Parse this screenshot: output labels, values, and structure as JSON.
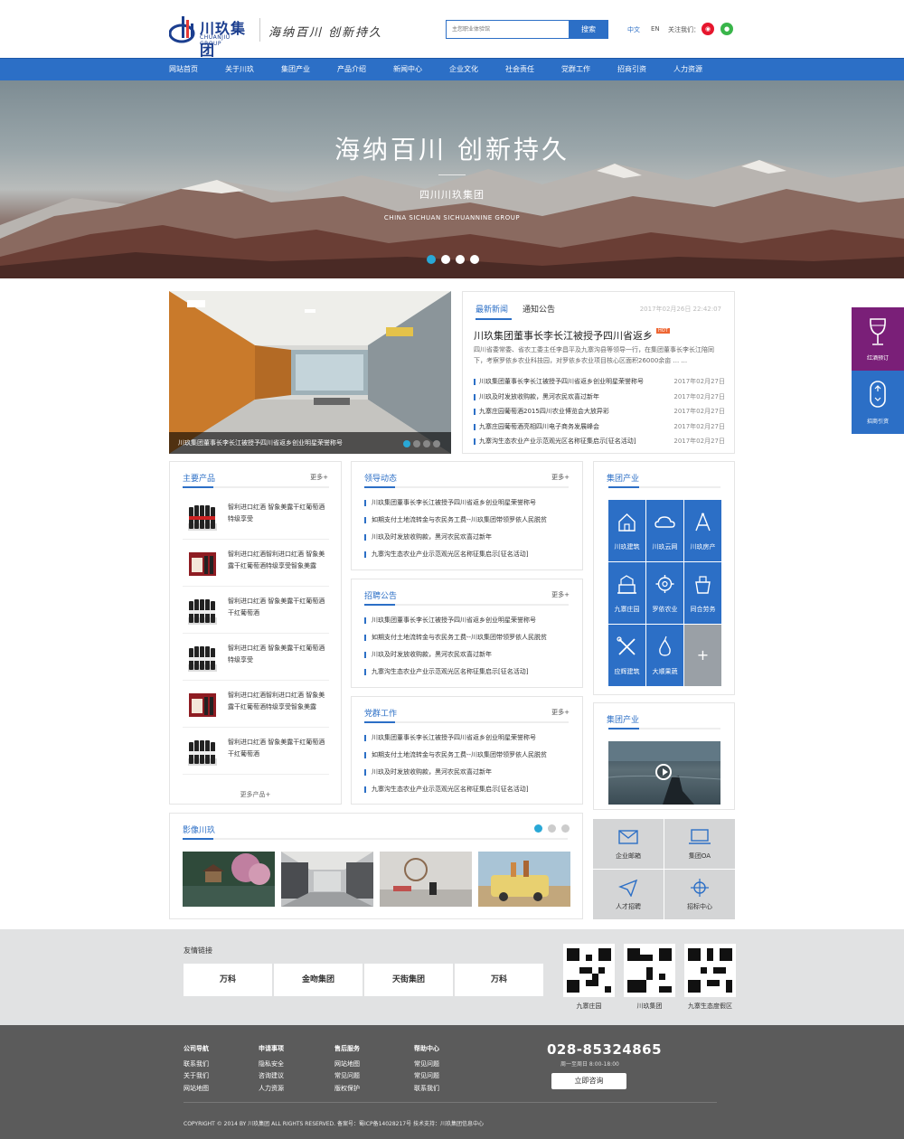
{
  "header": {
    "logo_cn": "川玖集团",
    "logo_en": "CHUANJIU GROUP",
    "slogan": "海纳百川 创新持久",
    "search_placeholder": "主您职业体验馆",
    "search_button": "搜索",
    "lang_cn": "中文",
    "lang_en": "EN",
    "follow": "关注我们：",
    "weibo_icon": "weibo-icon",
    "wechat_icon": "wechat-icon"
  },
  "nav": [
    "网站首页",
    "关于川玖",
    "集团产业",
    "产品介绍",
    "新闻中心",
    "企业文化",
    "社会责任",
    "党群工作",
    "招商引资",
    "人力资源"
  ],
  "hero": {
    "title": "海纳百川  创新持久",
    "subtitle": "四川川玖集团",
    "english": "CHINA  SICHUAN  SICHUANNINE  GROUP",
    "slides": 4,
    "active": 0
  },
  "news": {
    "caption": "川玖集团董事长李长江被授予四川省返乡创业明星荣誉称号",
    "tabs": [
      "最新新闻",
      "通知公告"
    ],
    "date": "2017年02月26日 22:42:07",
    "headline": "川玖集团董事长李长江被授予四川省返乡",
    "hot": "HOT",
    "summary": "四川省委常委、省农工委主任李昌平及九寨沟县等领导一行，在集团董事长李长江陪同下，考察罗依乡农业科技园，对罗依乡农业项目核心区面积26000余亩 ... ...",
    "items": [
      {
        "text": "川玖集团董事长李长江被授予四川省返乡创业明星荣誉称号",
        "date": "2017年02月27日"
      },
      {
        "text": "川玖及时发放收购款，黑河农民欢喜过新年",
        "date": "2017年02月27日"
      },
      {
        "text": "九寨庄园葡萄酒2015四川农业博览会大放异彩",
        "date": "2017年02月27日"
      },
      {
        "text": "九寨庄园葡萄酒亮相四川电子商务发展峰会",
        "date": "2017年02月27日"
      },
      {
        "text": "九寨沟生态农业产业示范观光区名称征集启示[征名活动]",
        "date": "2017年02月27日"
      }
    ]
  },
  "products": {
    "title": "主要产品",
    "more": "更多+",
    "items": [
      "智利进口红酒 智象美露干红葡萄酒特级享受",
      "智利进口红酒智利进口红酒 智象美露干红葡萄酒特级享受智象美露",
      "智利进口红酒 智象美露干红葡萄酒 干红葡萄酒",
      "智利进口红酒 智象美露干红葡萄酒特级享受",
      "智利进口红酒智利进口红酒 智象美露干红葡萄酒特级享受智象美露",
      "智利进口红酒 智象美露干红葡萄酒 干红葡萄酒"
    ],
    "more_products": "更多产品+"
  },
  "leader": {
    "title": "领导动态",
    "more": "更多+",
    "items": [
      "川玖集团董事长李长江被授予四川省返乡创业明星荣誉称号",
      "如期支付土地流转金与农民务工费--川玖集团带领罗依人民脱贫",
      "川玖及时发放收购款，黑河农民欢喜过新年",
      "九寨沟生态农业产业示范观光区名称征集启示[征名活动]"
    ]
  },
  "recruit": {
    "title": "招聘公告",
    "more": "更多+",
    "items": [
      "川玖集团董事长李长江被授予四川省返乡创业明星荣誉称号",
      "如期支付土地流转金与农民务工费--川玖集团带领罗依人民脱贫",
      "川玖及时发放收购款，黑河农民欢喜过新年",
      "九寨沟生态农业产业示范观光区名称征集启示[征名活动]"
    ]
  },
  "party": {
    "title": "党群工作",
    "more": "更多+",
    "items": [
      "川玖集团董事长李长江被授予四川省返乡创业明星荣誉称号",
      "如期支付土地流转金与农民务工费--川玖集团带领罗依人民脱贫",
      "川玖及时发放收购款，黑河农民欢喜过新年",
      "九寨沟生态农业产业示范观光区名称征集启示[征名活动]"
    ]
  },
  "industry": {
    "title": "集团产业",
    "cells": [
      {
        "label": "川玖建筑",
        "icon": "house-icon"
      },
      {
        "label": "川玖云网",
        "icon": "cloud-icon"
      },
      {
        "label": "川玖房产",
        "icon": "compass-icon"
      },
      {
        "label": "九寨庄园",
        "icon": "estate-icon"
      },
      {
        "label": "罗依农业",
        "icon": "gear-icon"
      },
      {
        "label": "同合劳务",
        "icon": "cup-icon"
      },
      {
        "label": "应辉建筑",
        "icon": "tools-icon"
      },
      {
        "label": "大顺果蔬",
        "icon": "pear-icon"
      }
    ],
    "plus": "+"
  },
  "video": {
    "title": "集团产业"
  },
  "gallery": {
    "title": "影像川玖",
    "pages": 3,
    "active": 0
  },
  "tiles": [
    {
      "label": "企业邮箱",
      "icon": "mail-icon"
    },
    {
      "label": "集团OA",
      "icon": "laptop-icon"
    },
    {
      "label": "人才招聘",
      "icon": "send-icon"
    },
    {
      "label": "招标中心",
      "icon": "crosshair-icon"
    }
  ],
  "links": {
    "title": "友情链接",
    "partners": [
      "万科",
      "金吻集团",
      "天街集团",
      "万科"
    ],
    "qrs": [
      "九寨庄园",
      "川玖集团",
      "九寨生态度假区"
    ]
  },
  "footer": {
    "cols": [
      {
        "title": "公司导航",
        "items": [
          "联系我们",
          "关于我们",
          "网站地图"
        ]
      },
      {
        "title": "申请事项",
        "items": [
          "隐私安全",
          "咨询建议",
          "人力资源"
        ]
      },
      {
        "title": "售后服务",
        "items": [
          "网站地图",
          "常见问题",
          "版权保护"
        ]
      },
      {
        "title": "帮助中心",
        "items": [
          "常见问题",
          "常见问题",
          "联系我们"
        ]
      }
    ],
    "phone": "028-85324865",
    "hours": "周一至周日 8:00-18:00",
    "consult": "立即咨询",
    "copyright": "COPYRIGHT © 2014 BY 川玖集团 ALL RIGHTS RESERVED.    备案号：蜀ICP备14028217号 技术支持：川玖集团信息中心"
  },
  "side": {
    "wine": "红酒预订",
    "invest": "招商引资"
  }
}
